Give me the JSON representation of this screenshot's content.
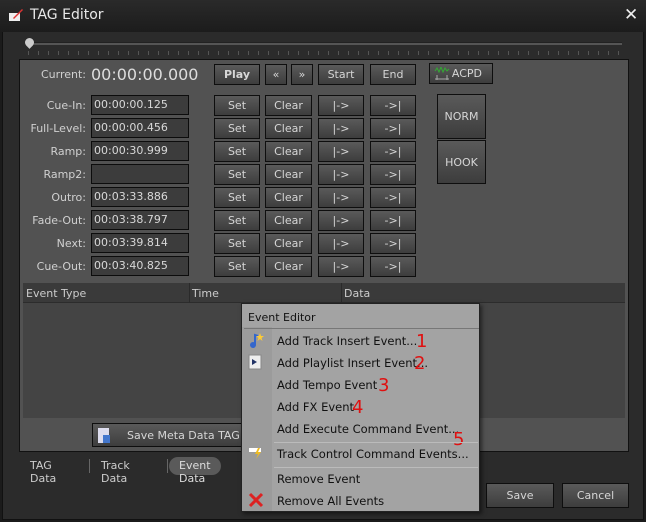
{
  "window": {
    "title": "TAG Editor",
    "close": "✕"
  },
  "current": {
    "label": "Current:",
    "value": "00:00:00.000"
  },
  "transport": {
    "play": "Play",
    "rewind": "«",
    "forward": "»",
    "start": "Start",
    "end": "End",
    "acpd": "ACPD"
  },
  "cues": [
    {
      "label": "Cue-In:",
      "value": "00:00:00.125"
    },
    {
      "label": "Full-Level:",
      "value": "00:00:00.456"
    },
    {
      "label": "Ramp:",
      "value": "00:00:30.999"
    },
    {
      "label": "Ramp2:",
      "value": ""
    },
    {
      "label": "Outro:",
      "value": "00:03:33.886"
    },
    {
      "label": "Fade-Out:",
      "value": "00:03:38.797"
    },
    {
      "label": "Next:",
      "value": "00:03:39.814"
    },
    {
      "label": "Cue-Out:",
      "value": "00:03:40.825"
    }
  ],
  "row_buttons": {
    "set": "Set",
    "clear": "Clear",
    "goto_in": "|->",
    "goto_out": "->|"
  },
  "side_buttons": {
    "norm": "NORM",
    "hook": "HOOK"
  },
  "event_table": {
    "columns": [
      "Event Type",
      "Time",
      "Data"
    ]
  },
  "save_meta": "Save Meta Data TAG",
  "tabs": [
    {
      "label": "TAG Data"
    },
    {
      "label": "Track Data"
    },
    {
      "label": "Event Data",
      "active": true
    }
  ],
  "footer": {
    "save": "Save",
    "cancel": "Cancel"
  },
  "context_menu": {
    "title": "Event Editor",
    "items": [
      {
        "label": "Add Track Insert Event...",
        "icon": "music-note-star-icon",
        "annotation": "1"
      },
      {
        "label": "Add Playlist Insert Event...",
        "icon": "playlist-icon",
        "annotation": "2"
      },
      {
        "label": "Add Tempo Event",
        "annotation": "3"
      },
      {
        "label": "Add FX Event",
        "annotation": "4"
      },
      {
        "label": "Add Execute Command Event...",
        "annotation": "5"
      },
      {
        "label": "Track Control Command Events...",
        "icon": "lightning-icon"
      },
      {
        "label": "Remove Event"
      },
      {
        "label": "Remove All Events",
        "icon": "red-x-icon"
      }
    ]
  },
  "colors": {
    "annotation": "#e01010",
    "panel": "#525252",
    "menu": "#a3a3a3"
  }
}
